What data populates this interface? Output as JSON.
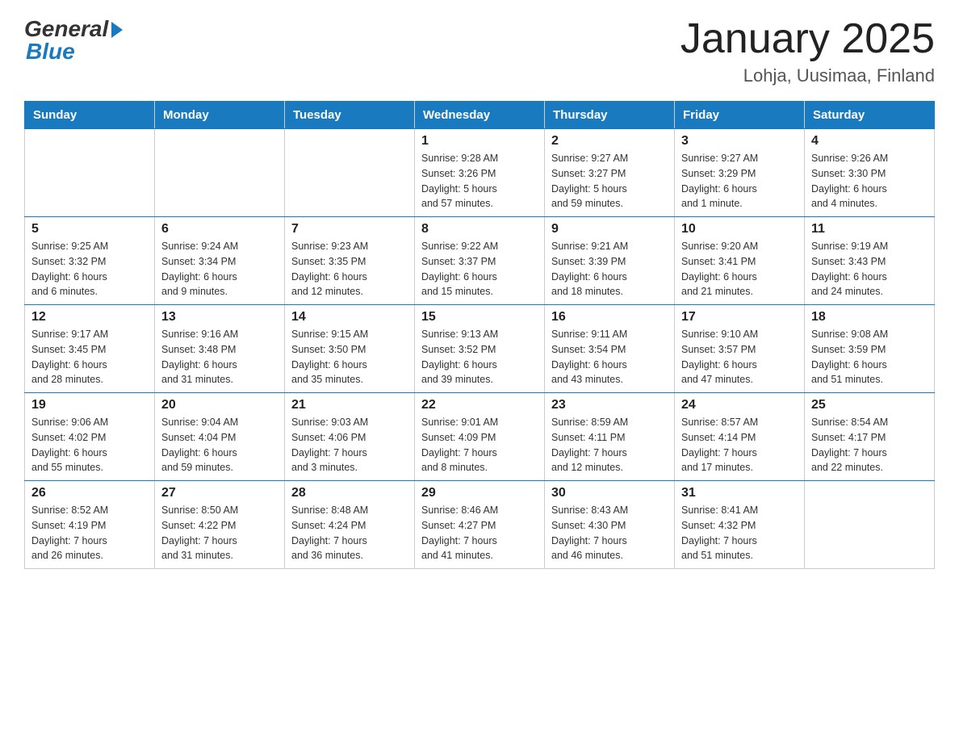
{
  "header": {
    "logo_general": "General",
    "logo_blue": "Blue",
    "month_title": "January 2025",
    "location": "Lohja, Uusimaa, Finland"
  },
  "days_of_week": [
    "Sunday",
    "Monday",
    "Tuesday",
    "Wednesday",
    "Thursday",
    "Friday",
    "Saturday"
  ],
  "weeks": [
    [
      {
        "day": "",
        "info": ""
      },
      {
        "day": "",
        "info": ""
      },
      {
        "day": "",
        "info": ""
      },
      {
        "day": "1",
        "info": "Sunrise: 9:28 AM\nSunset: 3:26 PM\nDaylight: 5 hours\nand 57 minutes."
      },
      {
        "day": "2",
        "info": "Sunrise: 9:27 AM\nSunset: 3:27 PM\nDaylight: 5 hours\nand 59 minutes."
      },
      {
        "day": "3",
        "info": "Sunrise: 9:27 AM\nSunset: 3:29 PM\nDaylight: 6 hours\nand 1 minute."
      },
      {
        "day": "4",
        "info": "Sunrise: 9:26 AM\nSunset: 3:30 PM\nDaylight: 6 hours\nand 4 minutes."
      }
    ],
    [
      {
        "day": "5",
        "info": "Sunrise: 9:25 AM\nSunset: 3:32 PM\nDaylight: 6 hours\nand 6 minutes."
      },
      {
        "day": "6",
        "info": "Sunrise: 9:24 AM\nSunset: 3:34 PM\nDaylight: 6 hours\nand 9 minutes."
      },
      {
        "day": "7",
        "info": "Sunrise: 9:23 AM\nSunset: 3:35 PM\nDaylight: 6 hours\nand 12 minutes."
      },
      {
        "day": "8",
        "info": "Sunrise: 9:22 AM\nSunset: 3:37 PM\nDaylight: 6 hours\nand 15 minutes."
      },
      {
        "day": "9",
        "info": "Sunrise: 9:21 AM\nSunset: 3:39 PM\nDaylight: 6 hours\nand 18 minutes."
      },
      {
        "day": "10",
        "info": "Sunrise: 9:20 AM\nSunset: 3:41 PM\nDaylight: 6 hours\nand 21 minutes."
      },
      {
        "day": "11",
        "info": "Sunrise: 9:19 AM\nSunset: 3:43 PM\nDaylight: 6 hours\nand 24 minutes."
      }
    ],
    [
      {
        "day": "12",
        "info": "Sunrise: 9:17 AM\nSunset: 3:45 PM\nDaylight: 6 hours\nand 28 minutes."
      },
      {
        "day": "13",
        "info": "Sunrise: 9:16 AM\nSunset: 3:48 PM\nDaylight: 6 hours\nand 31 minutes."
      },
      {
        "day": "14",
        "info": "Sunrise: 9:15 AM\nSunset: 3:50 PM\nDaylight: 6 hours\nand 35 minutes."
      },
      {
        "day": "15",
        "info": "Sunrise: 9:13 AM\nSunset: 3:52 PM\nDaylight: 6 hours\nand 39 minutes."
      },
      {
        "day": "16",
        "info": "Sunrise: 9:11 AM\nSunset: 3:54 PM\nDaylight: 6 hours\nand 43 minutes."
      },
      {
        "day": "17",
        "info": "Sunrise: 9:10 AM\nSunset: 3:57 PM\nDaylight: 6 hours\nand 47 minutes."
      },
      {
        "day": "18",
        "info": "Sunrise: 9:08 AM\nSunset: 3:59 PM\nDaylight: 6 hours\nand 51 minutes."
      }
    ],
    [
      {
        "day": "19",
        "info": "Sunrise: 9:06 AM\nSunset: 4:02 PM\nDaylight: 6 hours\nand 55 minutes."
      },
      {
        "day": "20",
        "info": "Sunrise: 9:04 AM\nSunset: 4:04 PM\nDaylight: 6 hours\nand 59 minutes."
      },
      {
        "day": "21",
        "info": "Sunrise: 9:03 AM\nSunset: 4:06 PM\nDaylight: 7 hours\nand 3 minutes."
      },
      {
        "day": "22",
        "info": "Sunrise: 9:01 AM\nSunset: 4:09 PM\nDaylight: 7 hours\nand 8 minutes."
      },
      {
        "day": "23",
        "info": "Sunrise: 8:59 AM\nSunset: 4:11 PM\nDaylight: 7 hours\nand 12 minutes."
      },
      {
        "day": "24",
        "info": "Sunrise: 8:57 AM\nSunset: 4:14 PM\nDaylight: 7 hours\nand 17 minutes."
      },
      {
        "day": "25",
        "info": "Sunrise: 8:54 AM\nSunset: 4:17 PM\nDaylight: 7 hours\nand 22 minutes."
      }
    ],
    [
      {
        "day": "26",
        "info": "Sunrise: 8:52 AM\nSunset: 4:19 PM\nDaylight: 7 hours\nand 26 minutes."
      },
      {
        "day": "27",
        "info": "Sunrise: 8:50 AM\nSunset: 4:22 PM\nDaylight: 7 hours\nand 31 minutes."
      },
      {
        "day": "28",
        "info": "Sunrise: 8:48 AM\nSunset: 4:24 PM\nDaylight: 7 hours\nand 36 minutes."
      },
      {
        "day": "29",
        "info": "Sunrise: 8:46 AM\nSunset: 4:27 PM\nDaylight: 7 hours\nand 41 minutes."
      },
      {
        "day": "30",
        "info": "Sunrise: 8:43 AM\nSunset: 4:30 PM\nDaylight: 7 hours\nand 46 minutes."
      },
      {
        "day": "31",
        "info": "Sunrise: 8:41 AM\nSunset: 4:32 PM\nDaylight: 7 hours\nand 51 minutes."
      },
      {
        "day": "",
        "info": ""
      }
    ]
  ]
}
